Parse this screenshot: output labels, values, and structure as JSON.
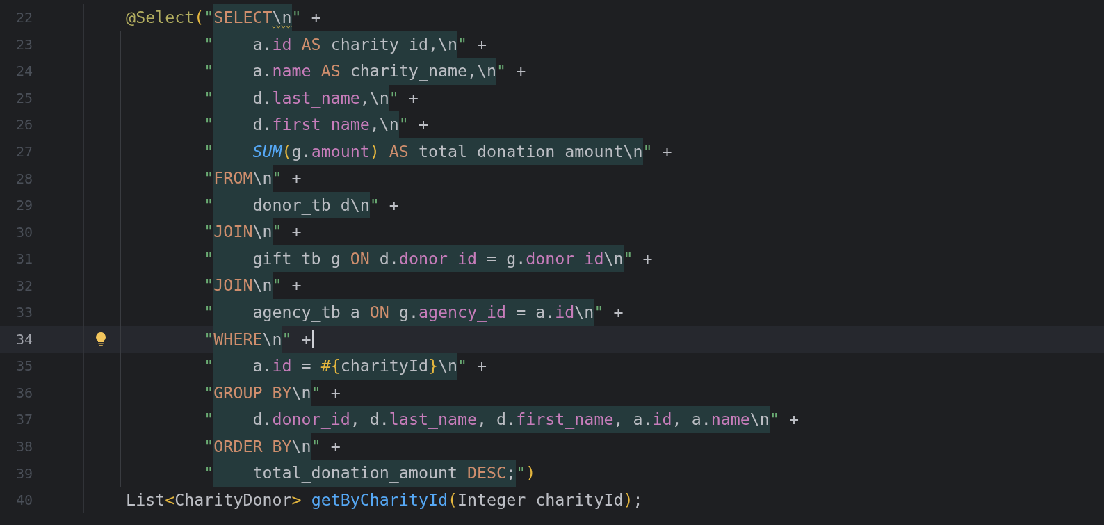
{
  "editor": {
    "lines": [
      {
        "number": "22",
        "current": false,
        "bulb": false,
        "caret": false,
        "pre": [
          {
            "text": "    @Select",
            "kind": "annotation"
          },
          {
            "text": "(",
            "kind": "paren"
          },
          {
            "text": "\"",
            "kind": "quote"
          }
        ],
        "sql": [
          {
            "text": "SELECT",
            "kind": "keyword"
          },
          {
            "text": "\\n",
            "kind": "plain",
            "warn": true
          }
        ],
        "post": [
          {
            "text": "\"",
            "kind": "quote"
          },
          {
            "text": " +",
            "kind": "plain"
          }
        ]
      },
      {
        "number": "23",
        "current": false,
        "bulb": false,
        "caret": false,
        "pre": [
          {
            "text": "            \"",
            "kind": "quote"
          }
        ],
        "sql": [
          {
            "text": "    a.",
            "kind": "plain"
          },
          {
            "text": "id",
            "kind": "field"
          },
          {
            "text": " AS ",
            "kind": "keyword"
          },
          {
            "text": "charity_id,\\n",
            "kind": "plain"
          }
        ],
        "post": [
          {
            "text": "\"",
            "kind": "quote"
          },
          {
            "text": " +",
            "kind": "plain"
          }
        ]
      },
      {
        "number": "24",
        "current": false,
        "bulb": false,
        "caret": false,
        "pre": [
          {
            "text": "            \"",
            "kind": "quote"
          }
        ],
        "sql": [
          {
            "text": "    a.",
            "kind": "plain"
          },
          {
            "text": "name",
            "kind": "field"
          },
          {
            "text": " AS ",
            "kind": "keyword"
          },
          {
            "text": "charity_name,\\n",
            "kind": "plain"
          }
        ],
        "post": [
          {
            "text": "\"",
            "kind": "quote"
          },
          {
            "text": " +",
            "kind": "plain"
          }
        ]
      },
      {
        "number": "25",
        "current": false,
        "bulb": false,
        "caret": false,
        "pre": [
          {
            "text": "            \"",
            "kind": "quote"
          }
        ],
        "sql": [
          {
            "text": "    d.",
            "kind": "plain"
          },
          {
            "text": "last_name",
            "kind": "field"
          },
          {
            "text": ",\\n",
            "kind": "plain"
          }
        ],
        "post": [
          {
            "text": "\"",
            "kind": "quote"
          },
          {
            "text": " +",
            "kind": "plain"
          }
        ]
      },
      {
        "number": "26",
        "current": false,
        "bulb": false,
        "caret": false,
        "pre": [
          {
            "text": "            \"",
            "kind": "quote"
          }
        ],
        "sql": [
          {
            "text": "    d.",
            "kind": "plain"
          },
          {
            "text": "first_name",
            "kind": "field"
          },
          {
            "text": ",\\n",
            "kind": "plain"
          }
        ],
        "post": [
          {
            "text": "\"",
            "kind": "quote"
          },
          {
            "text": " +",
            "kind": "plain"
          }
        ]
      },
      {
        "number": "27",
        "current": false,
        "bulb": false,
        "caret": false,
        "pre": [
          {
            "text": "            \"",
            "kind": "quote"
          }
        ],
        "sql": [
          {
            "text": "    SUM",
            "kind": "function"
          },
          {
            "text": "(",
            "kind": "paren"
          },
          {
            "text": "g.",
            "kind": "plain"
          },
          {
            "text": "amount",
            "kind": "field"
          },
          {
            "text": ")",
            "kind": "paren"
          },
          {
            "text": " AS ",
            "kind": "keyword"
          },
          {
            "text": "total_donation_amount\\n",
            "kind": "plain"
          }
        ],
        "post": [
          {
            "text": "\"",
            "kind": "quote"
          },
          {
            "text": " +",
            "kind": "plain"
          }
        ]
      },
      {
        "number": "28",
        "current": false,
        "bulb": false,
        "caret": false,
        "pre": [
          {
            "text": "            \"",
            "kind": "quote"
          }
        ],
        "sql": [
          {
            "text": "FROM",
            "kind": "keyword"
          },
          {
            "text": "\\n",
            "kind": "plain"
          }
        ],
        "post": [
          {
            "text": "\"",
            "kind": "quote"
          },
          {
            "text": " +",
            "kind": "plain"
          }
        ]
      },
      {
        "number": "29",
        "current": false,
        "bulb": false,
        "caret": false,
        "pre": [
          {
            "text": "            \"",
            "kind": "quote"
          }
        ],
        "sql": [
          {
            "text": "    donor_tb d\\n",
            "kind": "plain"
          }
        ],
        "post": [
          {
            "text": "\"",
            "kind": "quote"
          },
          {
            "text": " +",
            "kind": "plain"
          }
        ]
      },
      {
        "number": "30",
        "current": false,
        "bulb": false,
        "caret": false,
        "pre": [
          {
            "text": "            \"",
            "kind": "quote"
          }
        ],
        "sql": [
          {
            "text": "JOIN",
            "kind": "keyword"
          },
          {
            "text": "\\n",
            "kind": "plain"
          }
        ],
        "post": [
          {
            "text": "\"",
            "kind": "quote"
          },
          {
            "text": " +",
            "kind": "plain"
          }
        ]
      },
      {
        "number": "31",
        "current": false,
        "bulb": false,
        "caret": false,
        "pre": [
          {
            "text": "            \"",
            "kind": "quote"
          }
        ],
        "sql": [
          {
            "text": "    gift_tb g ",
            "kind": "plain"
          },
          {
            "text": "ON",
            "kind": "keyword"
          },
          {
            "text": " d.",
            "kind": "plain"
          },
          {
            "text": "donor_id",
            "kind": "field"
          },
          {
            "text": " = g.",
            "kind": "plain"
          },
          {
            "text": "donor_id",
            "kind": "field"
          },
          {
            "text": "\\n",
            "kind": "plain"
          }
        ],
        "post": [
          {
            "text": "\"",
            "kind": "quote"
          },
          {
            "text": " +",
            "kind": "plain"
          }
        ]
      },
      {
        "number": "32",
        "current": false,
        "bulb": false,
        "caret": false,
        "pre": [
          {
            "text": "            \"",
            "kind": "quote"
          }
        ],
        "sql": [
          {
            "text": "JOIN",
            "kind": "keyword"
          },
          {
            "text": "\\n",
            "kind": "plain"
          }
        ],
        "post": [
          {
            "text": "\"",
            "kind": "quote"
          },
          {
            "text": " +",
            "kind": "plain"
          }
        ]
      },
      {
        "number": "33",
        "current": false,
        "bulb": false,
        "caret": false,
        "pre": [
          {
            "text": "            \"",
            "kind": "quote"
          }
        ],
        "sql": [
          {
            "text": "    agency_tb a ",
            "kind": "plain"
          },
          {
            "text": "ON",
            "kind": "keyword"
          },
          {
            "text": " g.",
            "kind": "plain"
          },
          {
            "text": "agency_id",
            "kind": "field"
          },
          {
            "text": " = a.",
            "kind": "plain"
          },
          {
            "text": "id",
            "kind": "field"
          },
          {
            "text": "\\n",
            "kind": "plain"
          }
        ],
        "post": [
          {
            "text": "\"",
            "kind": "quote"
          },
          {
            "text": " +",
            "kind": "plain"
          }
        ]
      },
      {
        "number": "34",
        "current": true,
        "bulb": true,
        "caret": true,
        "pre": [
          {
            "text": "            \"",
            "kind": "quote"
          }
        ],
        "sql": [
          {
            "text": "WHERE",
            "kind": "keyword"
          },
          {
            "text": "\\n",
            "kind": "plain"
          }
        ],
        "post": [
          {
            "text": "\"",
            "kind": "quote"
          },
          {
            "text": " +",
            "kind": "plain"
          }
        ]
      },
      {
        "number": "35",
        "current": false,
        "bulb": false,
        "caret": false,
        "pre": [
          {
            "text": "            \"",
            "kind": "quote"
          }
        ],
        "sql": [
          {
            "text": "    a.",
            "kind": "plain"
          },
          {
            "text": "id",
            "kind": "field"
          },
          {
            "text": " = ",
            "kind": "plain"
          },
          {
            "text": "#{",
            "kind": "paren"
          },
          {
            "text": "charityId",
            "kind": "plain"
          },
          {
            "text": "}",
            "kind": "paren"
          },
          {
            "text": "\\n",
            "kind": "plain"
          }
        ],
        "post": [
          {
            "text": "\"",
            "kind": "quote"
          },
          {
            "text": " +",
            "kind": "plain"
          }
        ]
      },
      {
        "number": "36",
        "current": false,
        "bulb": false,
        "caret": false,
        "pre": [
          {
            "text": "            \"",
            "kind": "quote"
          }
        ],
        "sql": [
          {
            "text": "GROUP BY",
            "kind": "keyword"
          },
          {
            "text": "\\n",
            "kind": "plain"
          }
        ],
        "post": [
          {
            "text": "\"",
            "kind": "quote"
          },
          {
            "text": " +",
            "kind": "plain"
          }
        ]
      },
      {
        "number": "37",
        "current": false,
        "bulb": false,
        "caret": false,
        "pre": [
          {
            "text": "            \"",
            "kind": "quote"
          }
        ],
        "sql": [
          {
            "text": "    d.",
            "kind": "plain"
          },
          {
            "text": "donor_id",
            "kind": "field"
          },
          {
            "text": ", d.",
            "kind": "plain"
          },
          {
            "text": "last_name",
            "kind": "field"
          },
          {
            "text": ", d.",
            "kind": "plain"
          },
          {
            "text": "first_name",
            "kind": "field"
          },
          {
            "text": ", a.",
            "kind": "plain"
          },
          {
            "text": "id",
            "kind": "field"
          },
          {
            "text": ", a.",
            "kind": "plain"
          },
          {
            "text": "name",
            "kind": "field"
          },
          {
            "text": "\\n",
            "kind": "plain"
          }
        ],
        "post": [
          {
            "text": "\"",
            "kind": "quote"
          },
          {
            "text": " +",
            "kind": "plain"
          }
        ]
      },
      {
        "number": "38",
        "current": false,
        "bulb": false,
        "caret": false,
        "pre": [
          {
            "text": "            \"",
            "kind": "quote"
          }
        ],
        "sql": [
          {
            "text": "ORDER BY",
            "kind": "keyword"
          },
          {
            "text": "\\n",
            "kind": "plain"
          }
        ],
        "post": [
          {
            "text": "\"",
            "kind": "quote"
          },
          {
            "text": " +",
            "kind": "plain"
          }
        ]
      },
      {
        "number": "39",
        "current": false,
        "bulb": false,
        "caret": false,
        "pre": [
          {
            "text": "            \"",
            "kind": "quote"
          }
        ],
        "sql": [
          {
            "text": "    total_donation_amount ",
            "kind": "plain"
          },
          {
            "text": "DESC",
            "kind": "keyword"
          },
          {
            "text": ";",
            "kind": "plain"
          }
        ],
        "post": [
          {
            "text": "\"",
            "kind": "quote"
          },
          {
            "text": ")",
            "kind": "paren"
          }
        ]
      },
      {
        "number": "40",
        "current": false,
        "bulb": false,
        "caret": false,
        "pre": [
          {
            "text": "    List",
            "kind": "plain"
          },
          {
            "text": "<",
            "kind": "paren"
          },
          {
            "text": "CharityDonor",
            "kind": "plain"
          },
          {
            "text": "> ",
            "kind": "paren"
          },
          {
            "text": "getByCharityId",
            "kind": "method"
          },
          {
            "text": "(",
            "kind": "paren"
          },
          {
            "text": "Integer charityId",
            "kind": "plain"
          },
          {
            "text": ")",
            "kind": "paren"
          },
          {
            "text": ";",
            "kind": "plain"
          }
        ]
      }
    ]
  }
}
